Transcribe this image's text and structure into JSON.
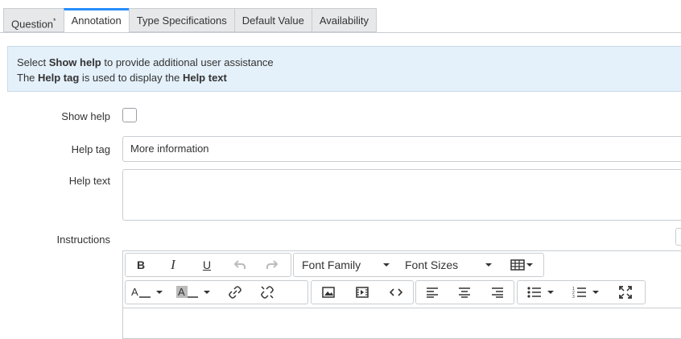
{
  "tabs": [
    {
      "label": "Question",
      "marker": "*"
    },
    {
      "label": "Annotation"
    },
    {
      "label": "Type Specifications"
    },
    {
      "label": "Default Value"
    },
    {
      "label": "Availability"
    }
  ],
  "info": {
    "line1_pre": "Select ",
    "line1_bold": "Show help",
    "line1_post": " to provide additional user assistance",
    "line2_pre": "The ",
    "line2_bold1": "Help tag",
    "line2_mid": " is used to display the ",
    "line2_bold2": "Help text"
  },
  "form": {
    "show_help_label": "Show help",
    "help_tag_label": "Help tag",
    "help_tag_value": "More information",
    "help_text_label": "Help text",
    "instructions_label": "Instructions"
  },
  "toolbar": {
    "bold": "B",
    "italic": "I",
    "underline": "U",
    "font_family": "Font Family",
    "font_sizes": "Font Sizes"
  },
  "colors": {
    "accent": "#278efc",
    "info_bg": "#e4f0fa"
  }
}
